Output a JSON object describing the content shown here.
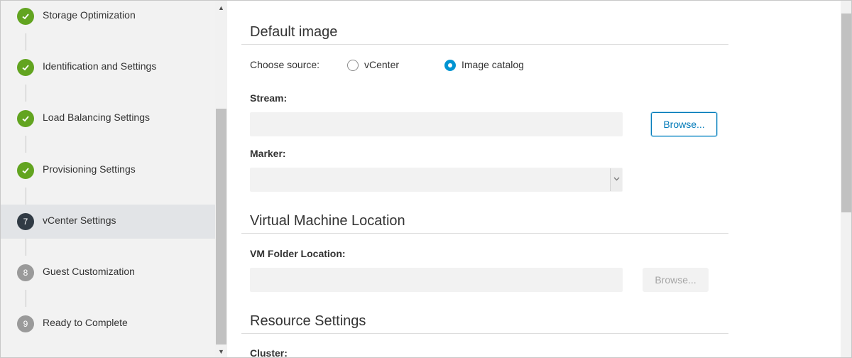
{
  "wizard": {
    "steps": [
      {
        "label": "Storage Optimization",
        "state": "done",
        "badge": ""
      },
      {
        "label": "Identification and Settings",
        "state": "done",
        "badge": ""
      },
      {
        "label": "Load Balancing Settings",
        "state": "done",
        "badge": ""
      },
      {
        "label": "Provisioning Settings",
        "state": "done",
        "badge": ""
      },
      {
        "label": "vCenter Settings",
        "state": "current",
        "badge": "7"
      },
      {
        "label": "Guest Customization",
        "state": "pending",
        "badge": "8"
      },
      {
        "label": "Ready to Complete",
        "state": "pending",
        "badge": "9"
      }
    ]
  },
  "default_image": {
    "title": "Default image",
    "choose_source_label": "Choose source:",
    "source_options": [
      {
        "label": "vCenter",
        "selected": false
      },
      {
        "label": "Image catalog",
        "selected": true
      }
    ],
    "stream_label": "Stream:",
    "stream_value": "",
    "browse_label": "Browse...",
    "marker_label": "Marker:",
    "marker_value": ""
  },
  "vm_location": {
    "title": "Virtual Machine Location",
    "folder_label": "VM Folder Location:",
    "folder_value": "",
    "browse_label": "Browse..."
  },
  "resource_settings": {
    "title": "Resource Settings",
    "cluster_label": "Cluster:"
  },
  "colors": {
    "done": "#62a420",
    "current": "#313b45",
    "pending": "#9a9a9a",
    "accent": "#0079b8",
    "radio": "#0094d2"
  }
}
